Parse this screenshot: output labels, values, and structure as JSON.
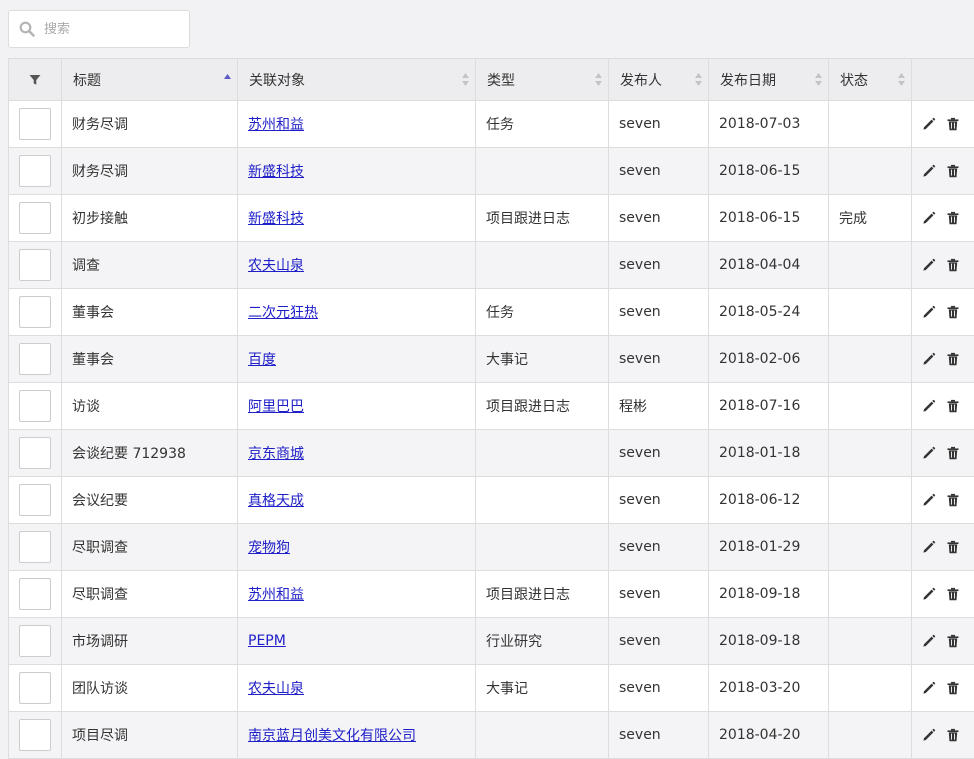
{
  "search": {
    "placeholder": "搜索"
  },
  "table": {
    "columns": [
      {
        "key": "filter",
        "label": ""
      },
      {
        "key": "title",
        "label": "标题",
        "sort": "asc"
      },
      {
        "key": "related",
        "label": "关联对象",
        "sort": "none"
      },
      {
        "key": "type",
        "label": "类型",
        "sort": "none"
      },
      {
        "key": "publisher",
        "label": "发布人",
        "sort": "none"
      },
      {
        "key": "date",
        "label": "发布日期",
        "sort": "none"
      },
      {
        "key": "status",
        "label": "状态",
        "sort": "none"
      },
      {
        "key": "actions",
        "label": ""
      }
    ],
    "rows": [
      {
        "title": "财务尽调",
        "related": "苏州和益",
        "type": "任务",
        "publisher": "seven",
        "date": "2018-07-03",
        "status": ""
      },
      {
        "title": "财务尽调",
        "related": "新盛科技",
        "type": "",
        "publisher": "seven",
        "date": "2018-06-15",
        "status": ""
      },
      {
        "title": "初步接触",
        "related": "新盛科技",
        "type": "项目跟进日志",
        "publisher": "seven",
        "date": "2018-06-15",
        "status": "完成"
      },
      {
        "title": "调查",
        "related": "农夫山泉",
        "type": "",
        "publisher": "seven",
        "date": "2018-04-04",
        "status": ""
      },
      {
        "title": "董事会",
        "related": "二次元狂热",
        "type": "任务",
        "publisher": "seven",
        "date": "2018-05-24",
        "status": ""
      },
      {
        "title": "董事会",
        "related": "百度",
        "type": "大事记",
        "publisher": "seven",
        "date": "2018-02-06",
        "status": ""
      },
      {
        "title": "访谈",
        "related": "阿里巴巴",
        "type": "项目跟进日志",
        "publisher": "程彬",
        "date": "2018-07-16",
        "status": ""
      },
      {
        "title": "会谈纪要 712938",
        "related": "京东商城",
        "type": "",
        "publisher": "seven",
        "date": "2018-01-18",
        "status": ""
      },
      {
        "title": "会议纪要",
        "related": "真格天成",
        "type": "",
        "publisher": "seven",
        "date": "2018-06-12",
        "status": ""
      },
      {
        "title": "尽职调查",
        "related": "宠物狗",
        "type": "",
        "publisher": "seven",
        "date": "2018-01-29",
        "status": ""
      },
      {
        "title": "尽职调查",
        "related": "苏州和益",
        "type": "项目跟进日志",
        "publisher": "seven",
        "date": "2018-09-18",
        "status": ""
      },
      {
        "title": "市场调研",
        "related": "PEPM",
        "type": "行业研究",
        "publisher": "seven",
        "date": "2018-09-18",
        "status": ""
      },
      {
        "title": "团队访谈",
        "related": "农夫山泉",
        "type": "大事记",
        "publisher": "seven",
        "date": "2018-03-20",
        "status": ""
      },
      {
        "title": "项目尽调",
        "related": "南京蓝月创美文化有限公司",
        "type": "",
        "publisher": "seven",
        "date": "2018-04-20",
        "status": ""
      }
    ]
  },
  "icons": {
    "search": "search-icon",
    "filter": "filter-icon",
    "edit": "pencil-icon",
    "delete": "trash-icon"
  },
  "colors": {
    "link": "#2020c8",
    "sort_active": "#5b5bc8",
    "sort_inactive": "#c4c4c4"
  }
}
